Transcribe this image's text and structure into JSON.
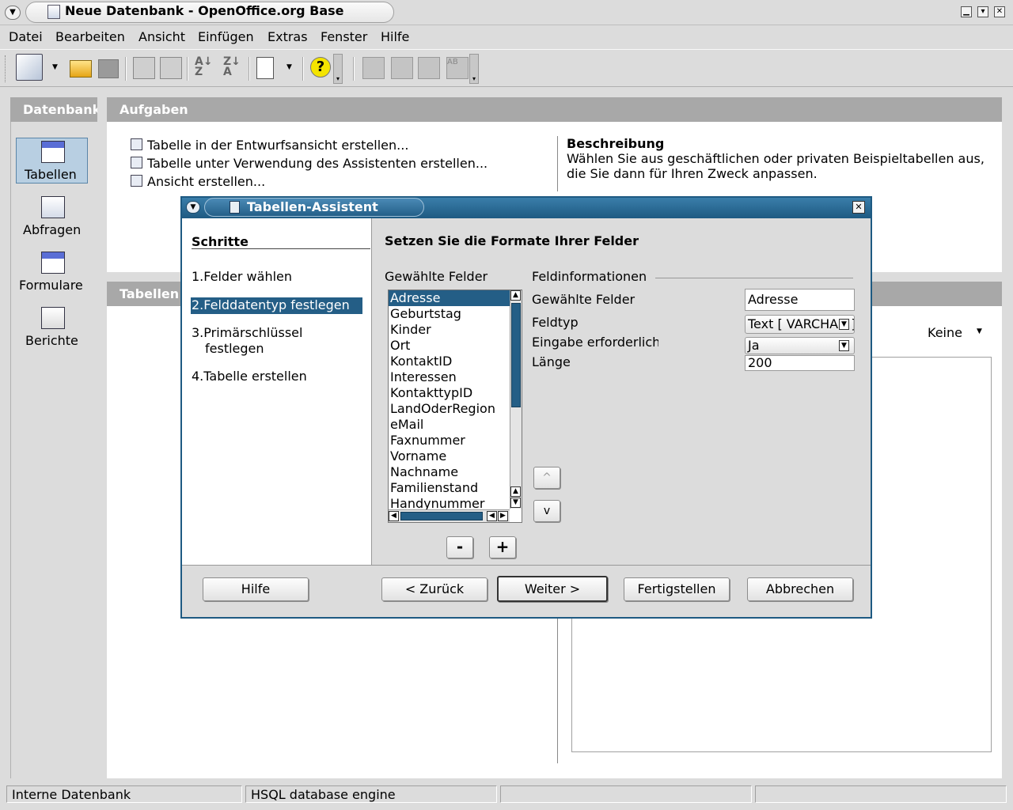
{
  "window": {
    "title": "Neue Datenbank - OpenOffice.org Base"
  },
  "menu": [
    "Datei",
    "Bearbeiten",
    "Ansicht",
    "Einfügen",
    "Extras",
    "Fenster",
    "Hilfe"
  ],
  "left_pane": {
    "header": "Datenbank",
    "items": [
      "Tabellen",
      "Abfragen",
      "Formulare",
      "Berichte"
    ],
    "selected": "Tabellen"
  },
  "tasks": {
    "header": "Aufgaben",
    "items": [
      "Tabelle in der Entwurfsansicht erstellen...",
      "Tabelle unter Verwendung des Assistenten erstellen...",
      "Ansicht erstellen..."
    ],
    "description_title": "Beschreibung",
    "description_line1": "Wählen Sie aus geschäftlichen oder privaten Beispieltabellen aus,",
    "description_line2": "die Sie dann für Ihren Zweck anpassen."
  },
  "tables_pane": {
    "header": "Tabellen",
    "preview_select": "Keine"
  },
  "dialog": {
    "title": "Tabellen-Assistent",
    "steps_title": "Schritte",
    "steps": [
      {
        "num": "1.",
        "label": "Felder wählen"
      },
      {
        "num": "2.",
        "label": "Felddatentyp festlegen"
      },
      {
        "num": "3.",
        "label": "Primärschlüssel",
        "label2": "festlegen"
      },
      {
        "num": "4.",
        "label": "Tabelle erstellen"
      }
    ],
    "active_step": 2,
    "heading": "Setzen Sie die Formate Ihrer Felder",
    "list_label": "Gewählte Felder",
    "fields": [
      "Adresse",
      "Geburtstag",
      "Kinder",
      "Ort",
      "KontaktID",
      "Interessen",
      "KontakttypID",
      "LandOderRegion",
      "eMail",
      "Faxnummer",
      "Vorname",
      "Nachname",
      "Familienstand",
      "Handynummer"
    ],
    "selected_field": "Adresse",
    "remove_button": "-",
    "add_button": "+",
    "info_group": "Feldinformationen",
    "info": {
      "field_name_label": "Gewählte Felder",
      "field_name_value": "Adresse",
      "type_label": "Feldtyp",
      "type_value": "Text [ VARCHAR ]",
      "required_label": "Eingabe erforderlich",
      "required_value": "Ja",
      "length_label": "Länge",
      "length_value": "200"
    },
    "move_up": "^",
    "move_down": "v",
    "buttons": {
      "help": "Hilfe",
      "back": "< Zurück",
      "next": "Weiter >",
      "finish": "Fertigstellen",
      "cancel": "Abbrechen"
    }
  },
  "status": {
    "cell1": "Interne Datenbank",
    "cell2": "HSQL database engine",
    "cell3": "",
    "cell4": ""
  },
  "colors": {
    "accent": "#1e5a82",
    "selection": "#245e86",
    "pane_header": "#a8a8a8"
  }
}
